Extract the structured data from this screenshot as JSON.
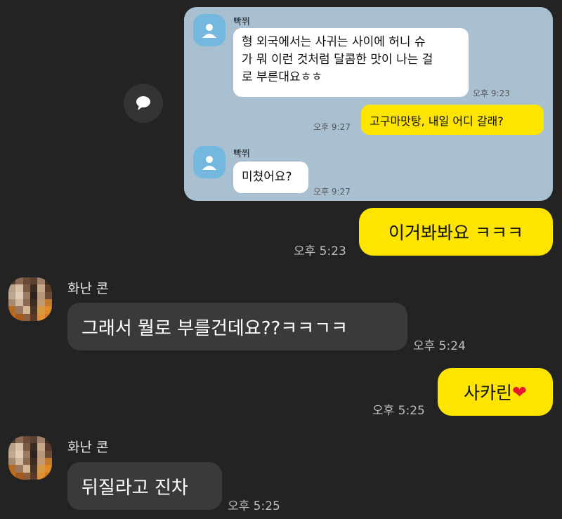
{
  "forwarded": {
    "sender_name": "빡쮜",
    "msg1_lines": [
      "형 외국에서는 사귀는 사이에 허니 슈",
      "가 뭐 이런 것처럼 달콤한 맛이 나는 걸",
      "로 부른대요ㅎㅎ"
    ],
    "msg1_time": "오후 9:23",
    "my_msg": "고구마맛탕, 내일 어디 갈래?",
    "my_msg_time": "오후 9:27",
    "msg2": "미쳤어요?",
    "msg2_time": "오후 9:27"
  },
  "chat": {
    "msg1": "이거봐봐요 ㅋㅋㅋ",
    "msg1_time": "오후 5:23",
    "other_name": "화난 콘",
    "msg2": "그래서 뭘로 부를건데요??ㅋㅋㄱㅋ",
    "msg2_time": "오후 5:24",
    "msg3": "사카린",
    "msg3_emoji": "❤",
    "msg3_time": "오후 5:25",
    "other_name2": "화난 콘",
    "msg4": "뒤질라고 진차",
    "msg4_time": "오후 5:25"
  },
  "icons": {
    "share": "speech-bubble-icon",
    "avatar": "person-icon"
  },
  "colors": {
    "background": "#232323",
    "card": "#a9c0d1",
    "yellow_bubble": "#fee500",
    "dark_bubble": "#3a3a3a"
  }
}
